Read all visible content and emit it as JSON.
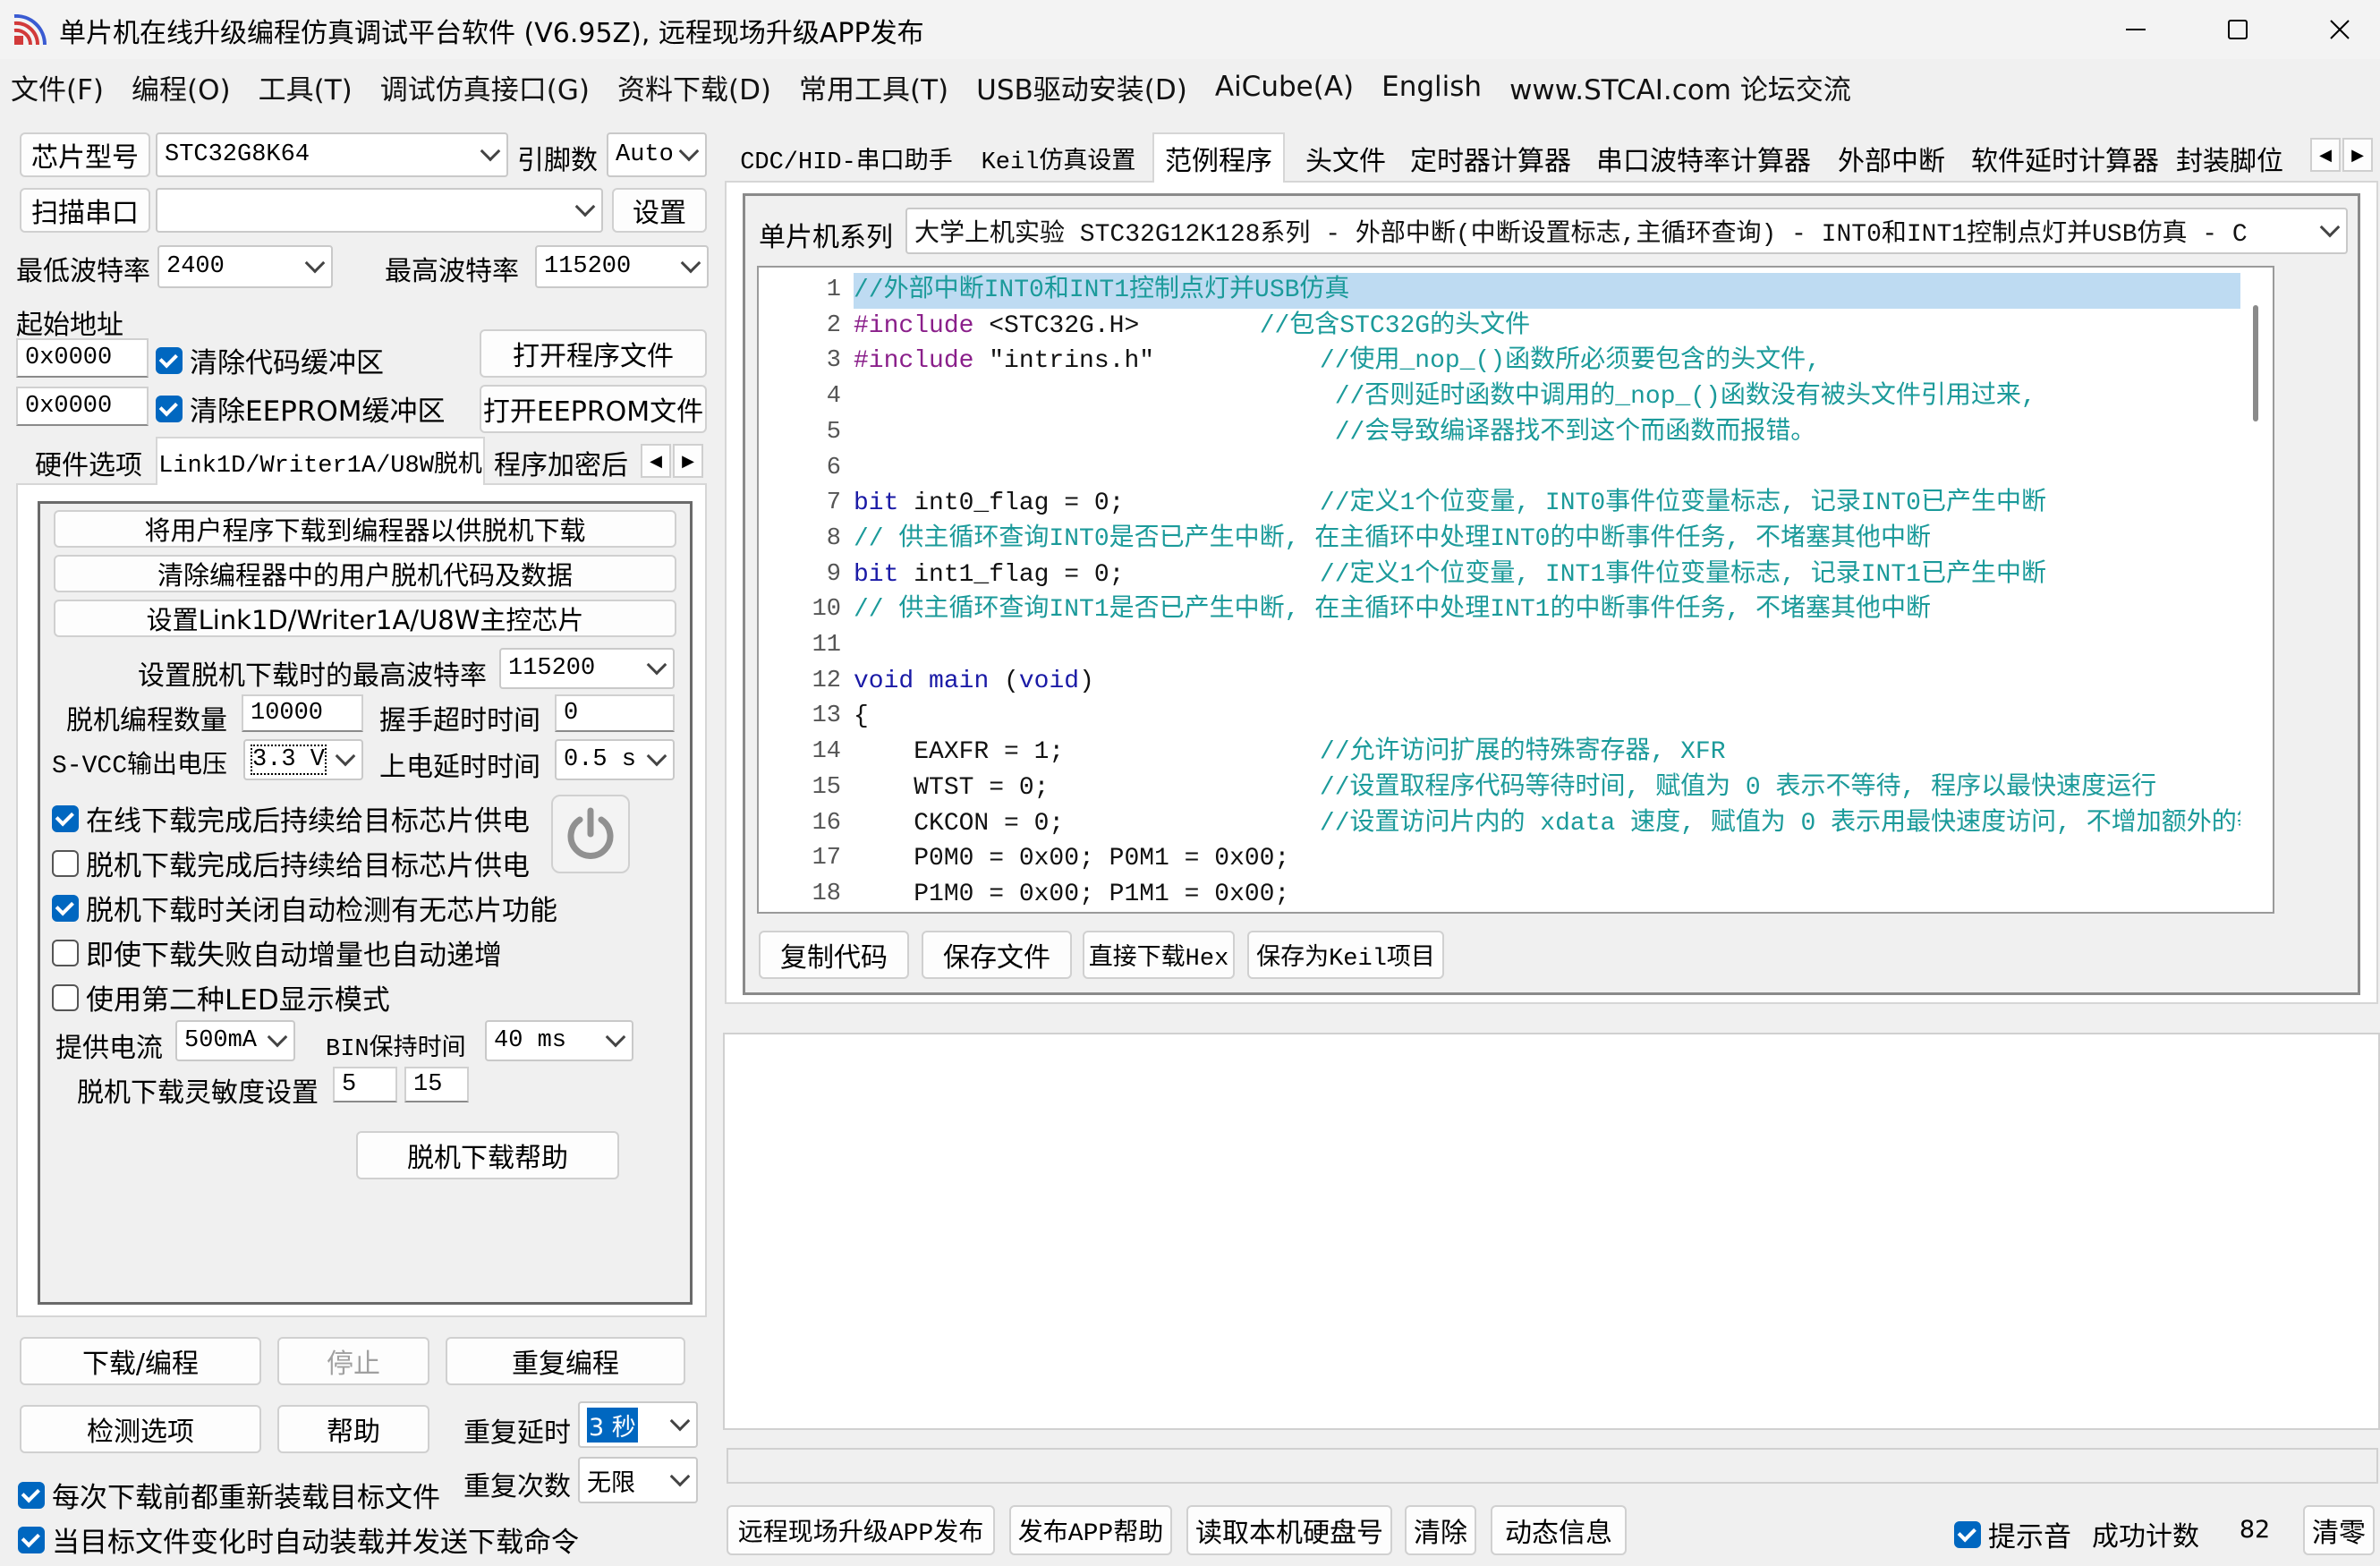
{
  "window": {
    "title": "单片机在线升级编程仿真调试平台软件 (V6.95Z), 远程现场升级APP发布",
    "minimize": "—",
    "maximize": "☐",
    "close": "✕"
  },
  "menu": [
    "文件(F)",
    "编程(O)",
    "工具(T)",
    "调试仿真接口(G)",
    "资料下载(D)",
    "常用工具(T)",
    "USB驱动安装(D)",
    "AiCube(A)",
    "English",
    "www.STCAI.com 论坛交流"
  ],
  "left": {
    "chip_label": "芯片型号",
    "chip_value": "STC32G8K64",
    "pins_label": "引脚数",
    "pins_value": "Auto",
    "scan_button": "扫描串口",
    "port_value": "",
    "settings_button": "设置",
    "min_baud_label": "最低波特率",
    "min_baud_value": "2400",
    "max_baud_label": "最高波特率",
    "max_baud_value": "115200",
    "start_addr_label": "起始地址",
    "addr1": "0x0000",
    "clear_code_label": "清除代码缓冲区",
    "open_program_button": "打开程序文件",
    "addr2": "0x0000",
    "clear_eeprom_label": "清除EEPROM缓冲区",
    "open_eeprom_button": "打开EEPROM文件",
    "tabs": [
      "硬件选项",
      "Link1D/Writer1A/U8W脱机",
      "程序加密后"
    ],
    "offline": {
      "btn_download": "将用户程序下载到编程器以供脱机下载",
      "btn_clear": "清除编程器中的用户脱机代码及数据",
      "btn_set_master": "设置Link1D/Writer1A/U8W主控芯片",
      "max_baud_label": "设置脱机下载时的最高波特率",
      "max_baud_value": "115200",
      "count_label": "脱机编程数量",
      "count_value": "10000",
      "handshake_label": "握手超时时间",
      "handshake_value": "0",
      "svcc_label": "S-VCC输出电压",
      "svcc_value": "3.3 V",
      "powerup_label": "上电延时时间",
      "powerup_value": "0.5 s",
      "chk_online_power": "在线下载完成后持续给目标芯片供电",
      "chk_offline_power": "脱机下载完成后持续给目标芯片供电",
      "chk_disable_detect": "脱机下载时关闭自动检测有无芯片功能",
      "chk_autoinc": "即使下载失败自动增量也自动递增",
      "chk_led": "使用第二种LED显示模式",
      "current_label": "提供电流",
      "current_value": "500mA",
      "bin_label": "BIN保持时间",
      "bin_value": "40 ms",
      "sensitivity_label": "脱机下载灵敏度设置",
      "sens1": "5",
      "sens2": "15",
      "help_button": "脱机下载帮助"
    },
    "download_button": "下载/编程",
    "stop_button": "停止",
    "repeat_button": "重复编程",
    "check_button": "检测选项",
    "help_button": "帮助",
    "repeat_delay_label": "重复延时",
    "repeat_delay_value": "3 秒",
    "repeat_count_label": "重复次数",
    "repeat_count_value": "无限",
    "chk_reload": "每次下载前都重新装载目标文件",
    "chk_autosend": "当目标文件变化时自动装载并发送下载命令"
  },
  "right": {
    "tabs": [
      "CDC/HID-串口助手",
      "Keil仿真设置",
      "范例程序",
      "头文件",
      "定时器计算器",
      "串口波特率计算器",
      "外部中断",
      "软件延时计算器",
      "封装脚位"
    ],
    "series_label": "单片机系列",
    "series_value": "大学上机实验 STC32G12K128系列 - 外部中断(中断设置标志,主循环查询) - INT0和INT1控制点灯并USB仿真 - C",
    "code_lines": [
      "//外部中断INT0和INT1控制点灯并USB仿真",
      "#include <STC32G.H>        //包含STC32G的头文件",
      "#include \"intrins.h\"           //使用_nop_()函数所必须要包含的头文件,",
      "                                //否则延时函数中调用的_nop_()函数没有被头文件引用过来,",
      "                                //会导致编译器找不到这个而函数而报错。",
      "",
      "bit int0_flag = 0;             //定义1个位变量, INT0事件位变量标志, 记录INT0已产生中断",
      "// 供主循环查询INT0是否已产生中断, 在主循环中处理INT0的中断事件任务, 不堵塞其他中断",
      "bit int1_flag = 0;             //定义1个位变量, INT1事件位变量标志, 记录INT1已产生中断",
      "// 供主循环查询INT1是否已产生中断, 在主循环中处理INT1的中断事件任务, 不堵塞其他中断",
      "",
      "void main (void)",
      "{",
      "    EAXFR = 1;                 //允许访问扩展的特殊寄存器, XFR",
      "    WTST = 0;                  //设置取程序代码等待时间, 赋值为 0 表示不等待, 程序以最快速度运行",
      "    CKCON = 0;                 //设置访问片内的 xdata 速度, 赋值为 0 表示用最快速度访问, 不增加额外的等待时间",
      "    P0M0 = 0x00; P0M1 = 0x00;",
      "    P1M0 = 0x00; P1M1 = 0x00;"
    ],
    "btn_copy": "复制代码",
    "btn_save": "保存文件",
    "btn_download_hex": "直接下载Hex",
    "btn_save_keil": "保存为Keil项目",
    "output_text": "",
    "bottom": {
      "btn_publish": "远程现场升级APP发布",
      "btn_publish_help": "发布APP帮助",
      "btn_read_disk": "读取本机硬盘号",
      "btn_clear": "清除",
      "btn_dynamic": "动态信息",
      "chk_sound": "提示音",
      "success_label": "成功计数",
      "success_value": "82",
      "btn_reset": "清零"
    }
  },
  "colors": {
    "accent": "#0067c0",
    "comment": "#1b9a9a",
    "keyword": "#1a1aa6",
    "preprocessor": "#8a1f8a",
    "highlight": "#bedbf2"
  }
}
